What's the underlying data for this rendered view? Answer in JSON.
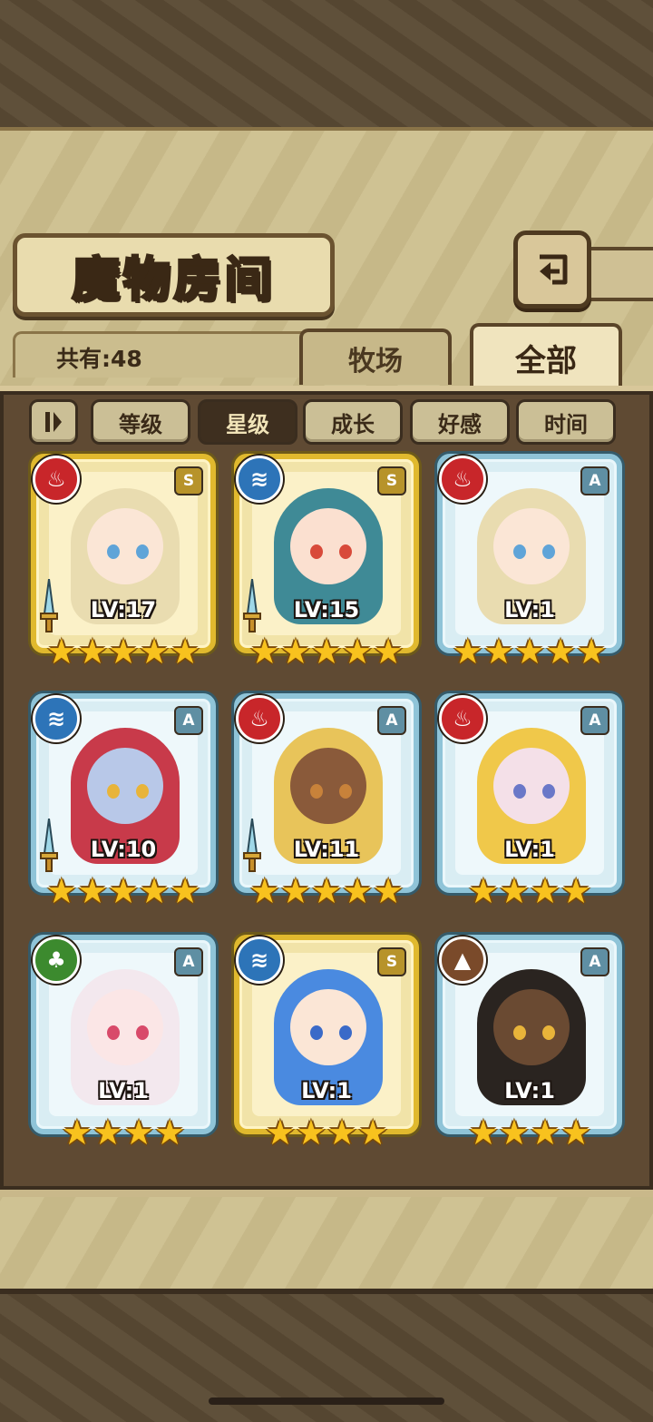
{
  "title": "魔物房间",
  "count_label": "共有:48",
  "tabs": [
    {
      "label": "牧场",
      "active": false
    },
    {
      "label": "全部",
      "active": true
    }
  ],
  "filters": [
    {
      "label": "等级",
      "active": false
    },
    {
      "label": "星级",
      "active": true
    },
    {
      "label": "成长",
      "active": false
    },
    {
      "label": "好感",
      "active": false
    },
    {
      "label": "时间",
      "active": false
    }
  ],
  "sort_icon": "sort-toggle-icon",
  "back_icon": "back-arrow-icon",
  "colors": {
    "fire": "#c8262a",
    "water": "#2d74b8",
    "grass": "#3c8a2e",
    "earth": "#7a4a2a",
    "gold_frame": "#e0b92e",
    "blue_frame": "#8fc4d8"
  },
  "monsters": [
    {
      "element": "fire",
      "rank": "S",
      "frame": "gold",
      "level": "LV:17",
      "stars": 5,
      "weapon": true,
      "hair": "#e9dcb0",
      "skin": "#fbe6d6",
      "eye": "#5fa4d8"
    },
    {
      "element": "water",
      "rank": "S",
      "frame": "gold",
      "level": "LV:15",
      "stars": 5,
      "weapon": true,
      "hair": "#3f8a96",
      "skin": "#fbe0d0",
      "eye": "#d84a3a"
    },
    {
      "element": "fire",
      "rank": "A",
      "frame": "blue",
      "level": "LV:1",
      "stars": 5,
      "weapon": false,
      "hair": "#e9dcb0",
      "skin": "#fbe6d6",
      "eye": "#5fa4d8"
    },
    {
      "element": "water",
      "rank": "A",
      "frame": "blue",
      "level": "LV:10",
      "stars": 5,
      "weapon": true,
      "hair": "#c83a4a",
      "skin": "#b8c8e8",
      "eye": "#e8b43a"
    },
    {
      "element": "fire",
      "rank": "A",
      "frame": "blue",
      "level": "LV:11",
      "stars": 5,
      "weapon": true,
      "hair": "#e8c45a",
      "skin": "#8a5a3a",
      "eye": "#c8823a"
    },
    {
      "element": "fire",
      "rank": "A",
      "frame": "blue",
      "level": "LV:1",
      "stars": 4,
      "weapon": false,
      "hair": "#f0c84a",
      "skin": "#f4e0e8",
      "eye": "#6a78c8"
    },
    {
      "element": "grass",
      "rank": "A",
      "frame": "blue",
      "level": "LV:1",
      "stars": 4,
      "weapon": false,
      "hair": "#f3e8ee",
      "skin": "#fbe6e6",
      "eye": "#d84a6a"
    },
    {
      "element": "water",
      "rank": "S",
      "frame": "gold",
      "level": "LV:1",
      "stars": 4,
      "weapon": false,
      "hair": "#4a8ae0",
      "skin": "#fbe6d6",
      "eye": "#3a6ac8"
    },
    {
      "element": "earth",
      "rank": "A",
      "frame": "blue",
      "level": "LV:1",
      "stars": 4,
      "weapon": false,
      "hair": "#2a2420",
      "skin": "#6a4a32",
      "eye": "#e8b43a"
    }
  ]
}
